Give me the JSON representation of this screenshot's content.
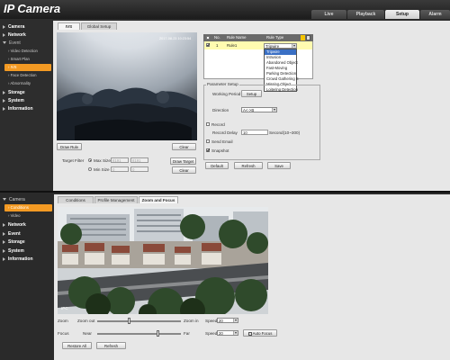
{
  "app": {
    "logo": "IP Camera"
  },
  "main_tabs": [
    "Live",
    "Playback",
    "Setup",
    "Alarm"
  ],
  "sidebar_top": {
    "items": [
      {
        "label": "Camera",
        "expanded": false
      },
      {
        "label": "Network",
        "expanded": false
      },
      {
        "label": "Event",
        "expanded": true
      }
    ],
    "event_sub": [
      "Video Detection",
      "Smart Plan",
      "IVS",
      "Face Detection",
      "Abnormality"
    ],
    "items_after": [
      "Storage",
      "System",
      "Information"
    ]
  },
  "ivs": {
    "tabs": [
      "IVS",
      "Global Setup"
    ],
    "preview_timestamp": "2017-08-23 10:23:54",
    "draw_rule": "Draw Rule",
    "clear": "Clear",
    "target_filter": "Target Filter",
    "max_size": "Max Size",
    "min_size": "Min Size",
    "max_val1": "8191",
    "max_val2": "8191",
    "min_val1": "0",
    "min_val2": "0",
    "draw_target": "Draw Target",
    "clear2": "Clear",
    "table_headers": [
      "No.",
      "Rule Name",
      "Rule Type"
    ],
    "rule_no": "1",
    "rule_name": "Rule1",
    "rule_type": "Tripwire",
    "rule_options": [
      "Tripwire",
      "Intrusion",
      "Abandoned Object",
      "Fast-Moving",
      "Parking Detection",
      "Crowd Gathering E",
      "Missing Object",
      "Loitering Detection"
    ],
    "param_setup": "Parameter Setup",
    "working_period": "Working Period",
    "setup": "Setup",
    "direction": "Direction",
    "direction_val": "A<->B",
    "record": "Record",
    "record_delay": "Record Delay",
    "record_delay_val": "10",
    "record_delay_unit": "Second(10~300)",
    "send_email": "Send Email",
    "snapshot": "Snapshot",
    "buttons": [
      "Default",
      "Refresh",
      "Save"
    ]
  },
  "sidebar_bottom": {
    "camera": "Camera",
    "camera_sub": [
      "Conditions",
      "Video"
    ],
    "items": [
      "Network",
      "Event",
      "Storage",
      "System",
      "Information"
    ]
  },
  "zoom": {
    "tabs": [
      "Conditions",
      "Profile Management",
      "Zoom and Focus"
    ],
    "osd": "IPC",
    "zoom_label": "Zoom",
    "zoom_out": "Zoom out",
    "zoom_in": "Zoom in",
    "focus_label": "Focus",
    "near": "Near",
    "far": "Far",
    "speed_label": "Speed",
    "zoom_speed": "20",
    "focus_speed": "20",
    "auto_focus": "Auto Focus",
    "restore": "Restore All",
    "refresh": "Refresh"
  },
  "colors": {
    "accent": "#f39a23",
    "rule_row": "#fffbb0",
    "highlight": "#3a6fc4"
  }
}
